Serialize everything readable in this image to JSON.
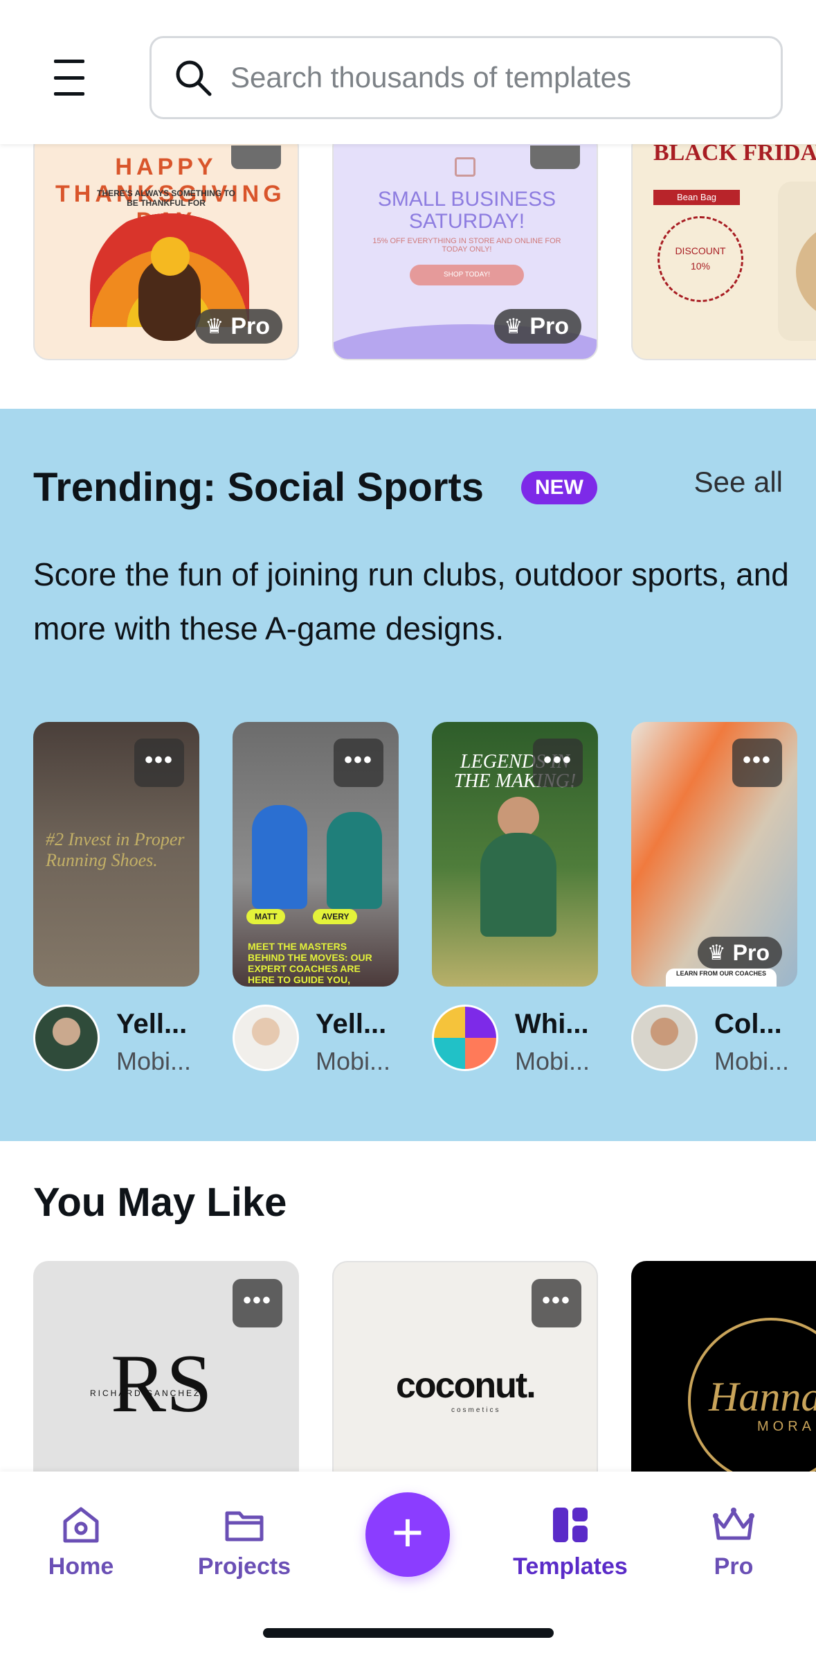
{
  "header": {
    "search_placeholder": "Search thousands of templates"
  },
  "top_cards": [
    {
      "title_art": "HAPPY THANKSGIVING DAY",
      "small_text": "THERE'S ALWAYS SOMETHING TO BE THANKFUL FOR",
      "badge": "Pro"
    },
    {
      "title_art": "SMALL BUSINESS SATURDAY!",
      "small_text": "15% OFF EVERYTHING IN STORE AND ONLINE FOR TODAY ONLY!",
      "button_text": "SHOP TODAY!",
      "badge": "Pro"
    },
    {
      "title_art": "BLACK FRIDAY",
      "tag": "Bean Bag",
      "discount_text": "DISCOUNT",
      "discount_value": "10%"
    }
  ],
  "trending": {
    "title": "Trending: Social Sports",
    "badge": "NEW",
    "see_all": "See all",
    "description": "Score the fun of joining run clubs, outdoor sports, and more with these A-game designs.",
    "cards": [
      {
        "name": "Yell...",
        "type": "Mobi...",
        "more": "•••",
        "art_text": "#2 Invest in Proper Running Shoes."
      },
      {
        "name": "Yell...",
        "type": "Mobi...",
        "more": "•••",
        "label_a": "MATT",
        "label_b": "AVERY",
        "art_text": "MEET THE MASTERS BEHIND THE MOVES: OUR EXPERT COACHES ARE HERE TO GUIDE YOU, CHALLENGE YOU, AND CELEBRATE YOUR VICTORIES"
      },
      {
        "name": "Whi...",
        "type": "Mobi...",
        "more": "•••",
        "art_text": "LEGENDS IN THE MAKING!"
      },
      {
        "name": "Col...",
        "type": "Mobi...",
        "more": "•••",
        "badge": "Pro",
        "art_text": "LEARN FROM OUR COACHES"
      }
    ]
  },
  "you_may_like": {
    "title": "You May Like",
    "cards": [
      {
        "logo": "RS",
        "logo_sub": "RICHARD SANCHEZ",
        "more": "•••"
      },
      {
        "logo": "coconut.",
        "logo_sub": "cosmetics",
        "more": "•••"
      },
      {
        "logo": "Hanna",
        "logo_sub": "MORAL"
      }
    ]
  },
  "bottom_nav": {
    "items": [
      {
        "label": "Home",
        "icon": "home-icon"
      },
      {
        "label": "Projects",
        "icon": "folder-icon"
      },
      {
        "label": "Templates",
        "icon": "templates-icon"
      },
      {
        "label": "Pro",
        "icon": "crown-icon"
      }
    ],
    "fab": "+"
  },
  "colors": {
    "accent": "#8b3dff",
    "trending_bg": "#a8d8ee",
    "nav_label": "#6a4fb5"
  }
}
